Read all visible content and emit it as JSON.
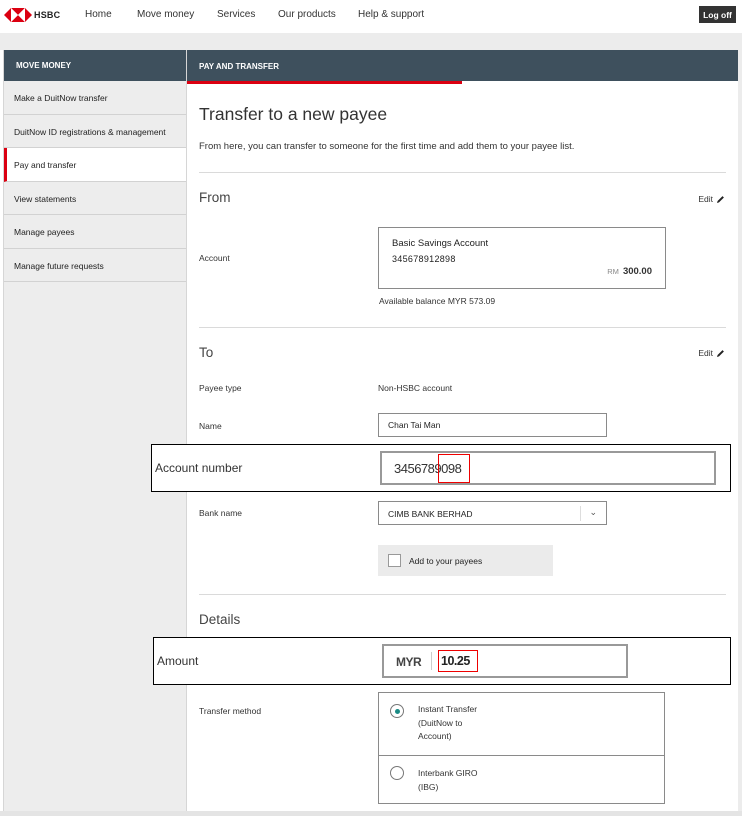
{
  "brand": {
    "name": "HSBC",
    "logo_color": "#db0011"
  },
  "topnav": {
    "items": [
      "Home",
      "Move money",
      "Services",
      "Our products",
      "Help & support"
    ],
    "logoff_label": "Log off"
  },
  "sidebar": {
    "heading": "MOVE MONEY",
    "items": [
      {
        "label": "Make a DuitNow transfer",
        "active": false
      },
      {
        "label": "DuitNow ID registrations & management",
        "active": false
      },
      {
        "label": "Pay and transfer",
        "active": true
      },
      {
        "label": "View statements",
        "active": false
      },
      {
        "label": "Manage payees",
        "active": false
      },
      {
        "label": "Manage future requests",
        "active": false
      }
    ]
  },
  "main": {
    "header": "PAY AND TRANSFER",
    "title": "Transfer to a new payee",
    "intro": "From here, you can transfer to someone for the first time and add them to your payee list.",
    "from": {
      "title": "From",
      "edit_label": "Edit",
      "account_label": "Account",
      "account_name": "Basic Savings Account",
      "account_number": "345678912898",
      "balance_currency": "RM",
      "balance": "300.00",
      "available": "Available balance MYR 573.09"
    },
    "to": {
      "title": "To",
      "edit_label": "Edit",
      "payee_type_label": "Payee type",
      "payee_type": "Non-HSBC account",
      "name_label": "Name",
      "name_value": "Chan Tai Man",
      "account_number_label": "Account number",
      "account_number_value": "3456789098",
      "bank_label": "Bank name",
      "bank_value": "CIMB BANK BERHAD",
      "add_payee_label": "Add to your payees",
      "add_payee_checked": false
    },
    "details": {
      "title": "Details",
      "amount_label": "Amount",
      "amount_currency": "MYR",
      "amount_value": "10.25",
      "method_label": "Transfer method",
      "methods": [
        {
          "lines": [
            "Instant Transfer",
            "(DuitNow to",
            "Account)"
          ],
          "selected": true
        },
        {
          "lines": [
            "Interbank GIRO",
            "(IBG)"
          ],
          "selected": false
        }
      ]
    }
  },
  "colors": {
    "accent_red": "#db0011",
    "header_bg": "#3e505d",
    "radio_selected": "#1a8a84"
  }
}
